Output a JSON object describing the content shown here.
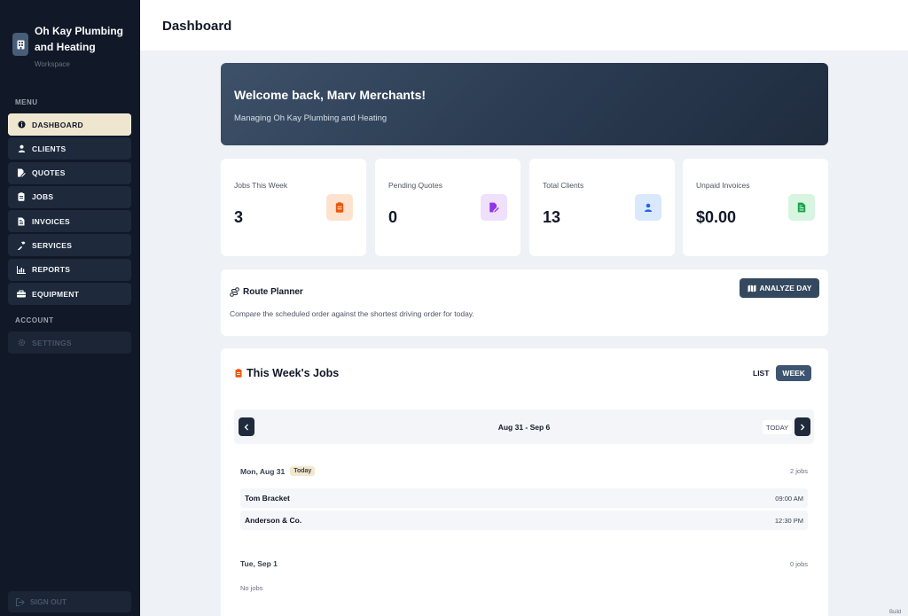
{
  "brand": {
    "name": "Oh Kay Plumbing and Heating",
    "subtitle": "Workspace"
  },
  "sidebar": {
    "menu_label": "MENU",
    "items": [
      {
        "label": "DASHBOARD",
        "icon": "info-circle-icon",
        "active": true
      },
      {
        "label": "CLIENTS",
        "icon": "user-icon"
      },
      {
        "label": "QUOTES",
        "icon": "file-signature-icon"
      },
      {
        "label": "JOBS",
        "icon": "clipboard-icon"
      },
      {
        "label": "INVOICES",
        "icon": "invoice-icon"
      },
      {
        "label": "SERVICES",
        "icon": "hammer-icon"
      },
      {
        "label": "REPORTS",
        "icon": "bar-chart-icon"
      },
      {
        "label": "EQUIPMENT",
        "icon": "toolbox-icon"
      }
    ],
    "account_label": "ACCOUNT",
    "settings_label": "SETTINGS",
    "signout_label": "SIGN OUT"
  },
  "header": {
    "title": "Dashboard"
  },
  "welcome": {
    "title": "Welcome back, Marv Merchants!",
    "subtitle": "Managing Oh Kay Plumbing and Heating"
  },
  "stats": [
    {
      "label": "Jobs This Week",
      "value": "3",
      "icon": "clipboard-icon",
      "bg": "#fde3cf",
      "fg": "#ea580c"
    },
    {
      "label": "Pending Quotes",
      "value": "0",
      "icon": "file-signature-icon",
      "bg": "#efe0fb",
      "fg": "#9333ea"
    },
    {
      "label": "Total Clients",
      "value": "13",
      "icon": "user-icon",
      "bg": "#d9e8fb",
      "fg": "#2563eb"
    },
    {
      "label": "Unpaid Invoices",
      "value": "$0.00",
      "icon": "invoice-icon",
      "bg": "#d8f5e1",
      "fg": "#16a34a"
    }
  ],
  "route_planner": {
    "title": "Route Planner",
    "description": "Compare the scheduled order against the shortest driving order for today.",
    "button_label": "ANALYZE DAY"
  },
  "jobs_panel": {
    "title": "This Week's Jobs",
    "view_list_label": "LIST",
    "view_week_label": "WEEK",
    "week_range": "Aug 31 - Sep 6",
    "today_label": "TODAY",
    "days": [
      {
        "label": "Mon, Aug 31",
        "tag": "Today",
        "count": "2 jobs",
        "jobs": [
          {
            "client": "Tom Bracket",
            "time": "09:00 AM"
          },
          {
            "client": "Anderson & Co.",
            "time": "12:30 PM"
          }
        ]
      },
      {
        "label": "Tue, Sep 1",
        "count": "0 jobs",
        "empty_text": "No jobs"
      }
    ]
  },
  "footer": {
    "build_label": "Build"
  }
}
